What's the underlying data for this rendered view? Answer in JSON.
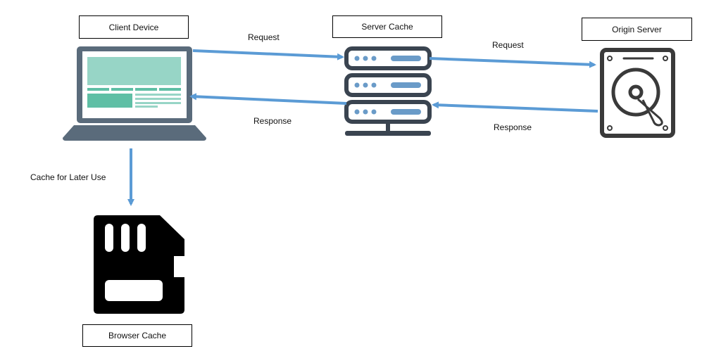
{
  "colors": {
    "arrow": "#5b9bd5",
    "device_frame": "#5a6b7b",
    "screen_light": "#97d5c6",
    "screen_dark": "#5fbfa5",
    "server_frame": "#3a4450",
    "server_accent": "#6a9bc8",
    "disk_frame": "#3a3a3a",
    "sd_card": "#000000"
  },
  "nodes": {
    "client_device": {
      "label": "Client Device",
      "icon": "laptop-icon"
    },
    "server_cache": {
      "label": "Server Cache",
      "icon": "server-rack-icon"
    },
    "origin_server": {
      "label": "Origin Server",
      "icon": "hard-drive-icon"
    },
    "browser_cache": {
      "label": "Browser Cache",
      "icon": "sd-card-icon"
    }
  },
  "edges": {
    "client_to_cache": {
      "label": "Request"
    },
    "cache_to_client": {
      "label": "Response"
    },
    "cache_to_origin": {
      "label": "Request"
    },
    "origin_to_cache": {
      "label": "Response"
    },
    "client_to_browser_cache": {
      "label": "Cache for Later Use"
    }
  }
}
